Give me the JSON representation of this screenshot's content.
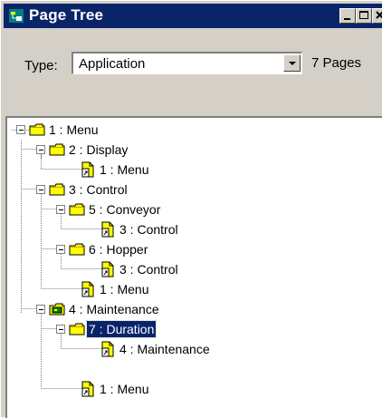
{
  "window": {
    "title": "Page Tree"
  },
  "filter": {
    "type_label": "Type:",
    "type_value": "Application",
    "page_count": "7 Pages"
  },
  "tree": {
    "nodes": [
      {
        "label": "1 : Menu"
      },
      {
        "label": "2 : Display"
      },
      {
        "label": "1 : Menu"
      },
      {
        "label": "3 : Control"
      },
      {
        "label": "5 : Conveyor"
      },
      {
        "label": "3 : Control"
      },
      {
        "label": "6 : Hopper"
      },
      {
        "label": "3 : Control"
      },
      {
        "label": "1 : Menu"
      },
      {
        "label": "4 : Maintenance"
      },
      {
        "label": "7 : Duration",
        "selected": true
      },
      {
        "label": "4 : Maintenance"
      },
      {
        "label": "1 : Menu"
      }
    ]
  },
  "colors": {
    "titlebar": "#0a246a",
    "folder": "#ffff00",
    "selection": "#0a246a"
  }
}
